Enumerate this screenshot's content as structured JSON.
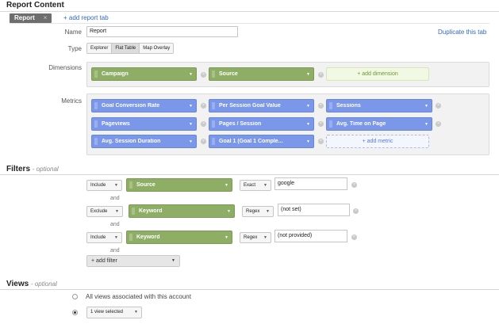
{
  "report_content": {
    "title": "Report Content",
    "tab_label": "Report",
    "tab_close": "×",
    "add_tab": "+ add report tab",
    "duplicate_tab": "Duplicate this tab"
  },
  "name_row": {
    "label": "Name",
    "value": "Report"
  },
  "type_row": {
    "label": "Type",
    "options": [
      "Explorer",
      "Flat Table",
      "Map Overlay"
    ],
    "selected": "Flat Table"
  },
  "dimensions": {
    "label": "Dimensions",
    "items": [
      "Campaign",
      "Source"
    ],
    "add_label": "+ add dimension"
  },
  "metrics": {
    "label": "Metrics",
    "items": [
      "Goal Conversion Rate",
      "Per Session Goal Value",
      "Sessions",
      "Pageviews",
      "Pages / Session",
      "Avg. Time on Page",
      "Avg. Session Duration",
      "Goal 1 (Goal 1 Comple..."
    ],
    "add_label": "+ add metric"
  },
  "filters": {
    "title": "Filters",
    "optional": "- optional",
    "and_label": "and",
    "rows": [
      {
        "mode": "Include",
        "dimension": "Source",
        "match": "Exact",
        "value": "google"
      },
      {
        "mode": "Exclude",
        "dimension": "Keyword",
        "match": "Regex",
        "value": "(not set)"
      },
      {
        "mode": "Include",
        "dimension": "Keyword",
        "match": "Regex",
        "value": "(not provided)"
      }
    ],
    "add_label": "+ add filter"
  },
  "views": {
    "title": "Views",
    "optional": "- optional",
    "all_views_label": "All views associated with this account",
    "selected_label": "1 view selected"
  },
  "icons": {
    "remove": "remove-icon",
    "caret": "caret-down-icon",
    "grip": "drag-handle-icon"
  },
  "colors": {
    "dimension_chip": "#8fae65",
    "metric_chip": "#7a97ea",
    "link": "#3366cc"
  }
}
